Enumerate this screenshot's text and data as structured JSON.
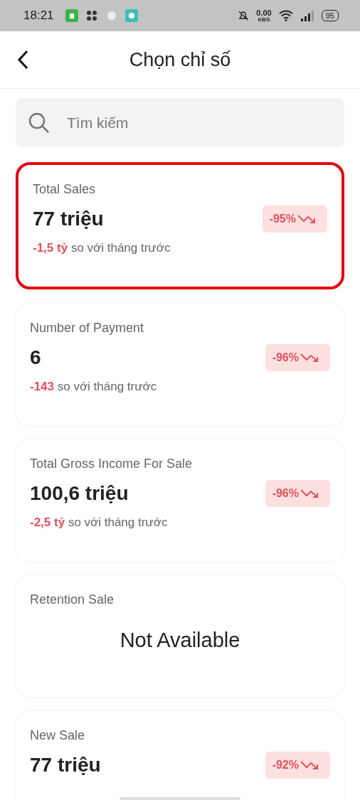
{
  "status_bar": {
    "time": "18:21",
    "speed": "0.00",
    "speed_unit": "KB/S",
    "battery": "95"
  },
  "header": {
    "title": "Chọn chỉ số"
  },
  "search": {
    "placeholder": "Tìm kiếm"
  },
  "cards": [
    {
      "kind": "metric",
      "selected": true,
      "title": "Total Sales",
      "value": "77 triệu",
      "change": "-95%",
      "delta": "-1,5 tỷ",
      "comparison": "so với tháng trước"
    },
    {
      "kind": "metric",
      "selected": false,
      "title": "Number of Payment",
      "value": "6",
      "change": "-96%",
      "delta": "-143",
      "comparison": "so với tháng trước"
    },
    {
      "kind": "metric",
      "selected": false,
      "title": "Total Gross Income For Sale",
      "value": "100,6 triệu",
      "change": "-96%",
      "delta": "-2,5 tỷ",
      "comparison": "so với tháng trước"
    },
    {
      "kind": "unavailable",
      "selected": false,
      "title": "Retention Sale",
      "value": "Not Available"
    },
    {
      "kind": "metric",
      "selected": false,
      "title": "New Sale",
      "value": "77 triệu",
      "change": "-92%"
    }
  ]
}
